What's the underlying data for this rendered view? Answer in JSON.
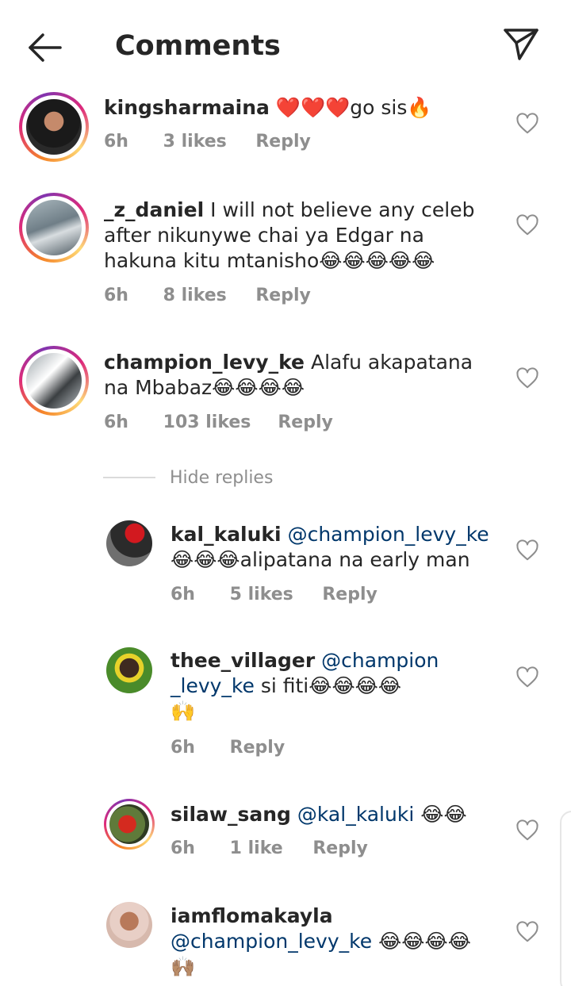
{
  "header": {
    "title": "Comments",
    "back_icon": "arrow-left-icon",
    "share_icon": "paper-plane-icon"
  },
  "comments": [
    {
      "username": "kingsharmaina",
      "text": "❤️❤️❤️go sis🔥",
      "time": "6h",
      "likes": "3 likes",
      "reply": "Reply"
    },
    {
      "username": "_z_daniel",
      "text": "I will not believe any celeb after nikunywe chai ya Edgar na hakuna kitu mtanisho😂😂😂😂😂",
      "time": "6h",
      "likes": "8 likes",
      "reply": "Reply"
    },
    {
      "username": "champion_levy_ke",
      "text": "Alafu akapatana na Mbabaz😂😂😂😂",
      "time": "6h",
      "likes": "103 likes",
      "reply": "Reply"
    }
  ],
  "hide_replies": "Hide replies",
  "replies": [
    {
      "username": "kal_kaluki",
      "mention": "@champion_levy_ke",
      "text": "😂😂😂alipatana na early man",
      "time": "6h",
      "likes": "5 likes",
      "reply": "Reply"
    },
    {
      "username": "thee_villager",
      "mention_line1": "@champion",
      "mention_line2": "_levy_ke",
      "text": "si fiti😂😂😂😂",
      "text2": "🙌",
      "time": "6h",
      "reply": "Reply"
    },
    {
      "username": "silaw_sang",
      "mention": "@kal_kaluki",
      "text": "😂😂",
      "time": "6h",
      "likes": "1 like",
      "reply": "Reply"
    },
    {
      "username": "iamflomakayla",
      "mention": "@champion_levy_ke",
      "text": "😂😂😂😂",
      "text2": "🙌🏽"
    }
  ],
  "colors": {
    "text": "#262626",
    "meta": "#8e8e8e",
    "mention": "#00376b",
    "divider": "#dbdbdb"
  }
}
